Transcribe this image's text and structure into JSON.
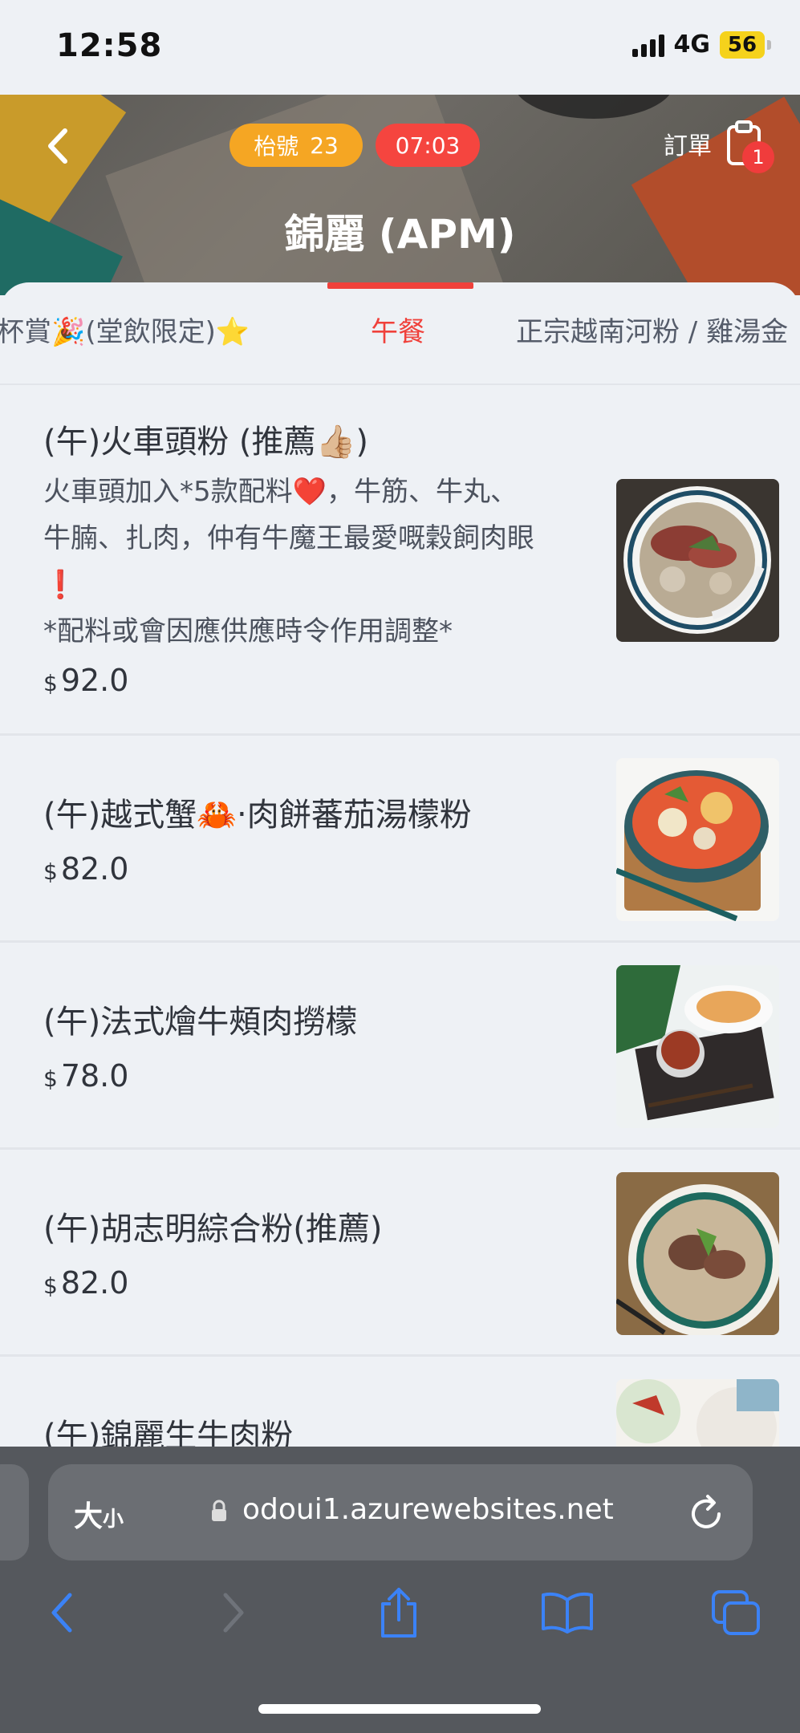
{
  "status_bar": {
    "time": "12:58",
    "network": "4G",
    "battery": "56"
  },
  "header": {
    "table_label": "枱號",
    "table_number": "23",
    "timer": "07:03",
    "orders_label": "訂單",
    "orders_count": "1",
    "store_name": "錦麗 (APM)"
  },
  "tabs": [
    {
      "label": "杯賞🎉(堂飲限定)⭐"
    },
    {
      "label": "午餐",
      "active": true
    },
    {
      "label": "正宗越南河粉 / 雞湯金"
    }
  ],
  "currency": "$",
  "menu": [
    {
      "title": "(午)火車頭粉 (推薦👍🏼)",
      "desc": "火車頭加入*5款配料❤️，牛筋、牛丸、牛腩、扎肉，仲有牛魔王最愛嘅穀飼肉眼❗\n*配料或會因應供應時令作用調整*",
      "price": "92.0"
    },
    {
      "title": "(午)越式蟹🦀‧肉餅蕃茄湯檬粉",
      "price": "82.0"
    },
    {
      "title": "(午)法式燴牛頰肉撈檬",
      "price": "78.0"
    },
    {
      "title": "(午)胡志明綜合粉(推薦)",
      "price": "82.0"
    },
    {
      "title": "(午)錦麗生牛肉粉"
    }
  ],
  "browser": {
    "text_size_label_big": "大",
    "text_size_label_small": "小",
    "url": "odoui1.azurewebsites.net"
  },
  "colors": {
    "accent": "#f0413b",
    "table_pill": "#f5a623",
    "timer_pill": "#f5453f",
    "browser_blue": "#3b82f6"
  }
}
